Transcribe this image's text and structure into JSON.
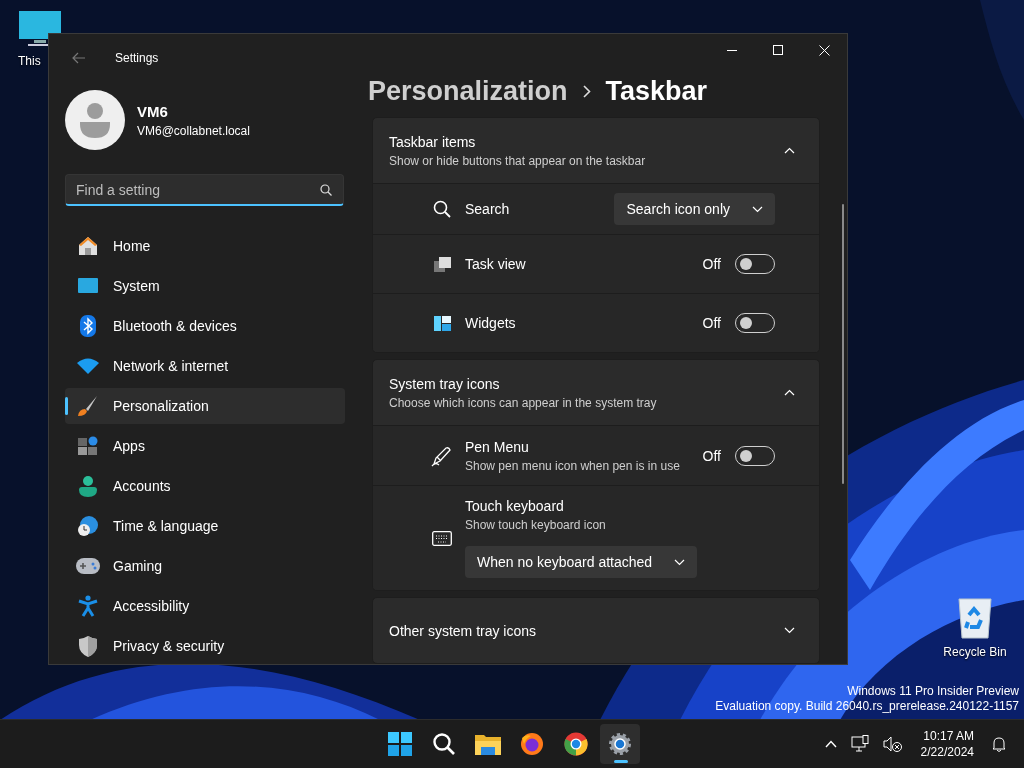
{
  "desktop_icons": [
    {
      "label": "This"
    },
    {
      "label": "Recycle Bin"
    }
  ],
  "desktop_notice": [
    "Windows 11 Pro Insider Preview",
    "Evaluation copy. Build 26040.rs_prerelease.240122-1157"
  ],
  "window": {
    "title": "Settings"
  },
  "account": {
    "name": "VM6",
    "email": "VM6@collabnet.local"
  },
  "search": {
    "placeholder": "Find a setting"
  },
  "nav": [
    {
      "label": "Home",
      "selected": false
    },
    {
      "label": "System",
      "selected": false
    },
    {
      "label": "Bluetooth & devices",
      "selected": false
    },
    {
      "label": "Network & internet",
      "selected": false
    },
    {
      "label": "Personalization",
      "selected": true
    },
    {
      "label": "Apps",
      "selected": false
    },
    {
      "label": "Accounts",
      "selected": false
    },
    {
      "label": "Time & language",
      "selected": false
    },
    {
      "label": "Gaming",
      "selected": false
    },
    {
      "label": "Accessibility",
      "selected": false
    },
    {
      "label": "Privacy & security",
      "selected": false
    }
  ],
  "breadcrumb": [
    "Personalization",
    "Taskbar"
  ],
  "sections": [
    {
      "title": "Taskbar items",
      "description": "Show or hide buttons that appear on the taskbar",
      "expanded": true,
      "rows": [
        {
          "kind": "dropdown",
          "label": "Search",
          "value": "Search icon only"
        },
        {
          "kind": "toggle",
          "label": "Task view",
          "state_label": "Off",
          "on": false
        },
        {
          "kind": "toggle",
          "label": "Widgets",
          "state_label": "Off",
          "on": false
        }
      ]
    },
    {
      "title": "System tray icons",
      "description": "Choose which icons can appear in the system tray",
      "expanded": true,
      "rows": [
        {
          "kind": "toggle",
          "label": "Pen Menu",
          "description": "Show pen menu icon when pen is in use",
          "state_label": "Off",
          "on": false
        },
        {
          "kind": "dropdown-below",
          "label": "Touch keyboard",
          "description": "Show touch keyboard icon",
          "value": "When no keyboard attached"
        }
      ]
    },
    {
      "title": "Other system tray icons",
      "expanded": false
    }
  ],
  "taskbar": {
    "apps": [
      {
        "running": false
      },
      {
        "running": false
      },
      {
        "running": false
      },
      {
        "running": false
      },
      {
        "running": false
      },
      {
        "running": true
      }
    ],
    "clock": {
      "time": "10:17 AM",
      "date": "2/22/2024"
    }
  }
}
